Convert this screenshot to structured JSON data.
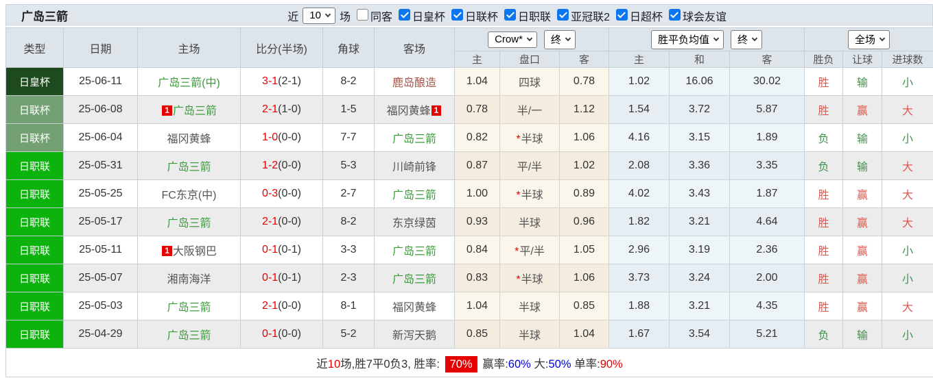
{
  "title": "广岛三箭",
  "filter_bar": {
    "near_label": "近",
    "matches_count": "10",
    "matches_label": "场",
    "checkboxes": [
      {
        "label": "同客",
        "checked": false
      },
      {
        "label": "日皇杯",
        "checked": true
      },
      {
        "label": "日联杯",
        "checked": true
      },
      {
        "label": "日职联",
        "checked": true
      },
      {
        "label": "亚冠联2",
        "checked": true
      },
      {
        "label": "日超杯",
        "checked": true
      },
      {
        "label": "球会友谊",
        "checked": true
      }
    ]
  },
  "table": {
    "col_headers": {
      "type": "类型",
      "date": "日期",
      "home": "主场",
      "score": "比分(半场)",
      "corner": "角球",
      "away": "客场"
    },
    "dropdowns": {
      "odds_company": "Crow*",
      "odds_time": "终",
      "avg_name": "胜平负均值",
      "avg_time": "终",
      "scope": "全场"
    },
    "sub_headers": [
      "主",
      "盘口",
      "客",
      "主",
      "和",
      "客",
      "胜负",
      "让球",
      "进球数"
    ],
    "league_colors": {
      "日皇杯": "#1d4b1d",
      "日联杯": "#73a173",
      "日职联": "#0cb30c"
    },
    "rows": [
      {
        "league": "日皇杯",
        "date": "25-06-11",
        "home": {
          "name": "广岛三箭(中)",
          "color": "green"
        },
        "score_full": "3-1",
        "score_half": "(2-1)",
        "corner": "8-2",
        "away": {
          "name": "鹿岛酿造",
          "color": "red"
        },
        "crow": {
          "home": "1.04",
          "star": false,
          "handicap": "四球",
          "away": "0.78"
        },
        "avg": {
          "home": "1.02",
          "draw": "16.06",
          "away": "30.02"
        },
        "result": {
          "text": "胜",
          "c": "r"
        },
        "handicap_result": {
          "text": "输",
          "c": "g"
        },
        "goals": {
          "text": "小",
          "c": "g"
        }
      },
      {
        "league": "日联杯",
        "date": "25-06-08",
        "home": {
          "badge_before": "1",
          "name": "广岛三箭",
          "color": "green"
        },
        "score_full": "2-1",
        "score_half": "(1-0)",
        "corner": "1-5",
        "away": {
          "name": "福冈黄蜂",
          "color": "dark",
          "badge_after": "1"
        },
        "crow": {
          "home": "0.78",
          "star": false,
          "handicap": "半/一",
          "away": "1.12"
        },
        "avg": {
          "home": "1.54",
          "draw": "3.72",
          "away": "5.87"
        },
        "result": {
          "text": "胜",
          "c": "r"
        },
        "handicap_result": {
          "text": "赢",
          "c": "r"
        },
        "goals": {
          "text": "大",
          "c": "r"
        }
      },
      {
        "league": "日联杯",
        "date": "25-06-04",
        "home": {
          "name": "福冈黄蜂",
          "color": "dark"
        },
        "score_full": "1-0",
        "score_half": "(0-0)",
        "corner": "7-7",
        "away": {
          "name": "广岛三箭",
          "color": "green"
        },
        "crow": {
          "home": "0.82",
          "star": true,
          "handicap": "半球",
          "away": "1.06"
        },
        "avg": {
          "home": "4.16",
          "draw": "3.15",
          "away": "1.89"
        },
        "result": {
          "text": "负",
          "c": "g"
        },
        "handicap_result": {
          "text": "输",
          "c": "g"
        },
        "goals": {
          "text": "小",
          "c": "g"
        }
      },
      {
        "league": "日职联",
        "date": "25-05-31",
        "home": {
          "name": "广岛三箭",
          "color": "green"
        },
        "score_full": "1-2",
        "score_half": "(0-0)",
        "corner": "5-3",
        "away": {
          "name": "川崎前锋",
          "color": "dark"
        },
        "crow": {
          "home": "0.87",
          "star": false,
          "handicap": "平/半",
          "away": "1.02"
        },
        "avg": {
          "home": "2.08",
          "draw": "3.36",
          "away": "3.35"
        },
        "result": {
          "text": "负",
          "c": "g"
        },
        "handicap_result": {
          "text": "输",
          "c": "g"
        },
        "goals": {
          "text": "大",
          "c": "r"
        }
      },
      {
        "league": "日职联",
        "date": "25-05-25",
        "home": {
          "name": "FC东京(中)",
          "color": "dark"
        },
        "score_full": "0-3",
        "score_half": "(0-0)",
        "corner": "2-7",
        "away": {
          "name": "广岛三箭",
          "color": "green"
        },
        "crow": {
          "home": "1.00",
          "star": true,
          "handicap": "半球",
          "away": "0.89"
        },
        "avg": {
          "home": "4.02",
          "draw": "3.43",
          "away": "1.87"
        },
        "result": {
          "text": "胜",
          "c": "r"
        },
        "handicap_result": {
          "text": "赢",
          "c": "r"
        },
        "goals": {
          "text": "大",
          "c": "r"
        }
      },
      {
        "league": "日职联",
        "date": "25-05-17",
        "home": {
          "name": "广岛三箭",
          "color": "green"
        },
        "score_full": "2-1",
        "score_half": "(0-0)",
        "corner": "8-2",
        "away": {
          "name": "东京绿茵",
          "color": "dark"
        },
        "crow": {
          "home": "0.93",
          "star": false,
          "handicap": "半球",
          "away": "0.96"
        },
        "avg": {
          "home": "1.82",
          "draw": "3.21",
          "away": "4.64"
        },
        "result": {
          "text": "胜",
          "c": "r"
        },
        "handicap_result": {
          "text": "赢",
          "c": "r"
        },
        "goals": {
          "text": "大",
          "c": "r"
        }
      },
      {
        "league": "日职联",
        "date": "25-05-11",
        "home": {
          "badge_before": "1",
          "name": "大阪钢巴",
          "color": "dark"
        },
        "score_full": "0-1",
        "score_half": "(0-1)",
        "corner": "3-3",
        "away": {
          "name": "广岛三箭",
          "color": "green"
        },
        "crow": {
          "home": "0.84",
          "star": true,
          "handicap": "平/半",
          "away": "1.05"
        },
        "avg": {
          "home": "2.96",
          "draw": "3.19",
          "away": "2.36"
        },
        "result": {
          "text": "胜",
          "c": "r"
        },
        "handicap_result": {
          "text": "赢",
          "c": "r"
        },
        "goals": {
          "text": "小",
          "c": "g"
        }
      },
      {
        "league": "日职联",
        "date": "25-05-07",
        "home": {
          "name": "湘南海洋",
          "color": "dark"
        },
        "score_full": "0-1",
        "score_half": "(0-1)",
        "corner": "2-3",
        "away": {
          "name": "广岛三箭",
          "color": "green"
        },
        "crow": {
          "home": "0.83",
          "star": true,
          "handicap": "半球",
          "away": "1.06"
        },
        "avg": {
          "home": "3.73",
          "draw": "3.24",
          "away": "2.00"
        },
        "result": {
          "text": "胜",
          "c": "r"
        },
        "handicap_result": {
          "text": "赢",
          "c": "r"
        },
        "goals": {
          "text": "小",
          "c": "g"
        }
      },
      {
        "league": "日职联",
        "date": "25-05-03",
        "home": {
          "name": "广岛三箭",
          "color": "green"
        },
        "score_full": "2-1",
        "score_half": "(0-0)",
        "corner": "8-1",
        "away": {
          "name": "福冈黄蜂",
          "color": "dark"
        },
        "crow": {
          "home": "1.04",
          "star": false,
          "handicap": "半球",
          "away": "0.85"
        },
        "avg": {
          "home": "1.88",
          "draw": "3.21",
          "away": "4.35"
        },
        "result": {
          "text": "胜",
          "c": "r"
        },
        "handicap_result": {
          "text": "赢",
          "c": "r"
        },
        "goals": {
          "text": "大",
          "c": "r"
        }
      },
      {
        "league": "日职联",
        "date": "25-04-29",
        "home": {
          "name": "广岛三箭",
          "color": "green"
        },
        "score_full": "0-1",
        "score_half": "(0-0)",
        "corner": "5-2",
        "away": {
          "name": "新泻天鹅",
          "color": "dark"
        },
        "crow": {
          "home": "0.85",
          "star": false,
          "handicap": "半球",
          "away": "1.04"
        },
        "avg": {
          "home": "1.67",
          "draw": "3.54",
          "away": "5.21"
        },
        "result": {
          "text": "负",
          "c": "g"
        },
        "handicap_result": {
          "text": "输",
          "c": "g"
        },
        "goals": {
          "text": "小",
          "c": "g"
        }
      }
    ]
  },
  "summary": {
    "segments": [
      {
        "text": "近",
        "style": "plain"
      },
      {
        "text": "10",
        "style": "red"
      },
      {
        "text": "场,胜7平0负3, 胜率: ",
        "style": "plain"
      },
      {
        "text": "70%",
        "style": "badge-red"
      },
      {
        "text": " 赢率:",
        "style": "plain"
      },
      {
        "text": "60%",
        "style": "blue"
      },
      {
        "text": " 大:",
        "style": "plain"
      },
      {
        "text": "50%",
        "style": "blue"
      },
      {
        "text": " 单率:",
        "style": "plain"
      },
      {
        "text": "90%",
        "style": "red"
      }
    ]
  },
  "colors": {
    "accent_red": "#e60000",
    "accent_blue": "#0000dd",
    "team_green": "#3a9b3a",
    "team_red": "#a3544b",
    "result_red": "#df584e",
    "result_green": "#43914d",
    "checkbox_blue": "#0b76ef",
    "header_bg": "#dde4ea"
  }
}
